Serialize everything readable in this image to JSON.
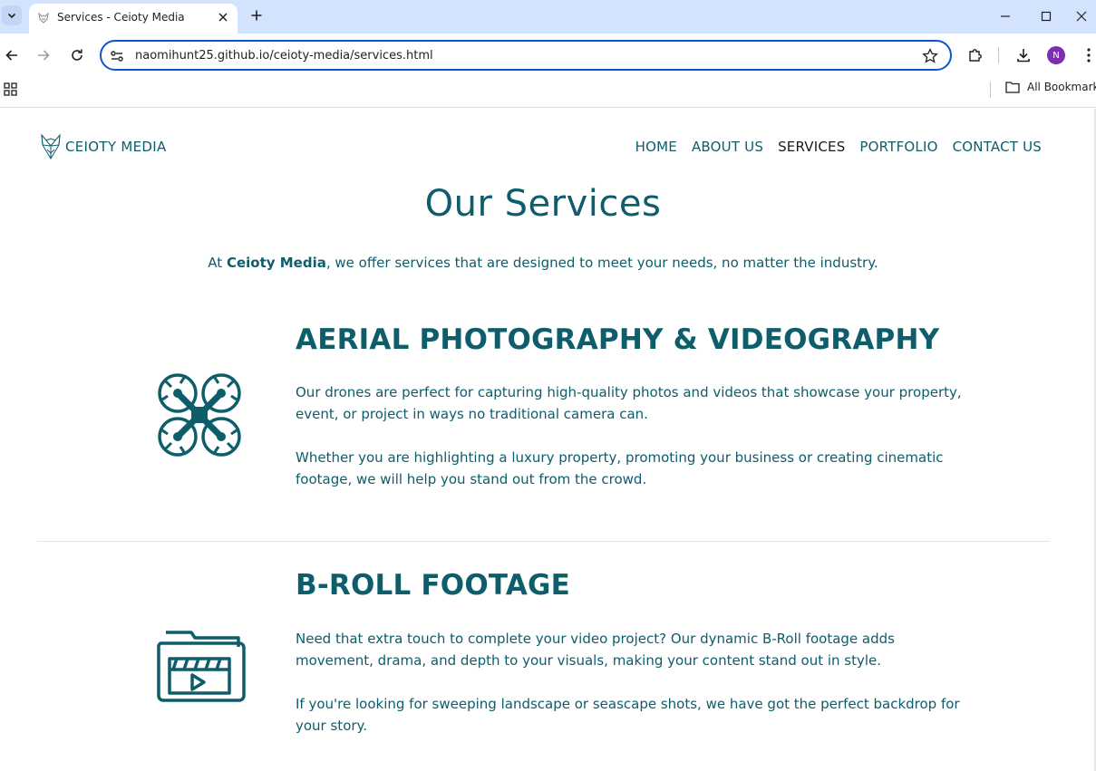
{
  "browser": {
    "tab_title": "Services - Ceioty Media",
    "url": "naomihunt25.github.io/ceioty-media/services.html",
    "profile_initial": "N",
    "bookmarks_label": "All Bookmarks"
  },
  "site": {
    "logo_text": "CEIOTY MEDIA",
    "nav": [
      {
        "label": "HOME",
        "active": false
      },
      {
        "label": "ABOUT US",
        "active": false
      },
      {
        "label": "SERVICES",
        "active": true
      },
      {
        "label": "PORTFOLIO",
        "active": false
      },
      {
        "label": "CONTACT US",
        "active": false
      }
    ]
  },
  "main": {
    "title": "Our Services",
    "intro_prefix": "At ",
    "intro_brand": "Ceioty Media",
    "intro_suffix": ", we offer services that are designed to meet your needs, no matter the industry.",
    "services": [
      {
        "icon": "drone-icon",
        "title": "AERIAL PHOTOGRAPHY & VIDEOGRAPHY",
        "paragraphs": [
          "Our drones are perfect for capturing high-quality photos and videos that showcase your property, event, or project in ways no traditional camera can.",
          "Whether you are highlighting a luxury property, promoting your business or creating cinematic footage, we will help you stand out from the crowd."
        ]
      },
      {
        "icon": "video-folder-icon",
        "title": "B-ROLL FOOTAGE",
        "paragraphs": [
          "Need that extra touch to complete your video project? Our dynamic B-Roll footage adds movement, drama, and depth to your visuals, making your content stand out in style.",
          "If you're looking for sweeping landscape or seascape shots, we have got the perfect backdrop for your story."
        ]
      }
    ]
  },
  "colors": {
    "brand": "#0d5d6a",
    "active_nav": "#1a1a1a",
    "tabstrip": "#d3e3fd",
    "focus_ring": "#0b57d0"
  }
}
